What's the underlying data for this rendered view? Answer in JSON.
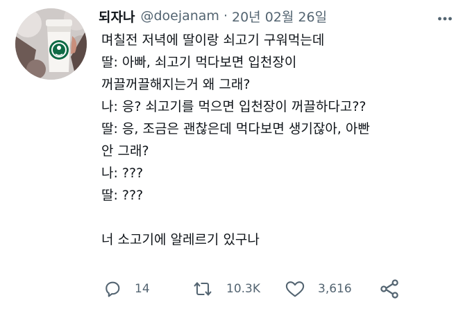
{
  "user": {
    "display_name": "되자나",
    "handle": "@doejanam",
    "separator": "·",
    "date": "20년 02월 26일"
  },
  "tweet": {
    "lines": [
      "며칠전 저녁에 딸이랑 쇠고기 구워먹는데",
      "딸: 아빠, 쇠고기 먹다보면 입천장이",
      "꺼끌꺼끌해지는거 왜 그래?",
      "나: 응? 쇠고기를 먹으면 입천장이 꺼끌하다고??",
      "딸: 응, 조금은 괜찮은데 먹다보면 생기잖아, 아빤",
      "안 그래?",
      "나: ???",
      "딸: ???",
      "",
      "너 소고기에 알레르기 있구나"
    ]
  },
  "actions": {
    "reply": {
      "icon": "reply-icon",
      "count": "14"
    },
    "retweet": {
      "icon": "retweet-icon",
      "count": "10.3K"
    },
    "like": {
      "icon": "heart-icon",
      "count": "3,616"
    },
    "share": {
      "icon": "share-icon"
    }
  },
  "more": {
    "icon": "more-dots-icon"
  },
  "colors": {
    "text": "#0f1419",
    "secondary": "#536471",
    "icon": "#536471",
    "background": "#ffffff"
  }
}
